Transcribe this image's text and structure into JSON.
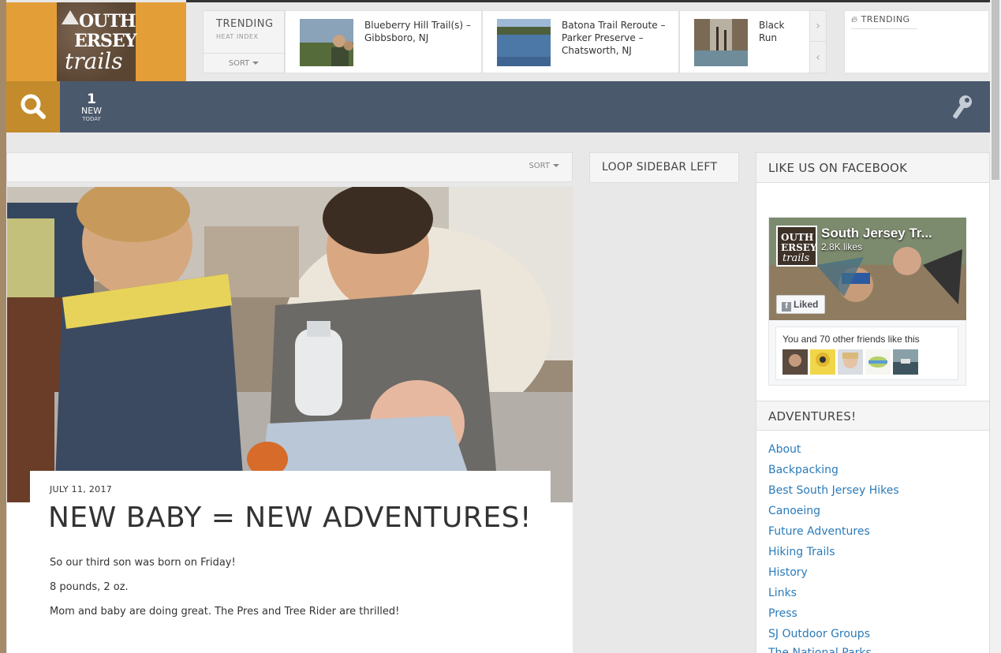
{
  "site": {
    "logo_text": "South Jersey Trails"
  },
  "trending": {
    "label": "TRENDING",
    "sublabel": "HEAT INDEX",
    "sort_label": "SORT",
    "items": [
      {
        "title": "Blueberry Hill Trail(s) – Gibbsboro, NJ"
      },
      {
        "title": "Batona Trail Reroute – Parker Preserve – Chatsworth, NJ"
      },
      {
        "title": "Black Run Trails – Eve"
      }
    ],
    "widget_label": "TRENDING"
  },
  "navbar": {
    "new_count": "1",
    "new_label": "NEW",
    "today_label": "TODAY"
  },
  "content": {
    "sort_label": "SORT",
    "post": {
      "date": "JULY 11, 2017",
      "title": "NEW BABY = NEW ADVENTURES!",
      "paragraphs": [
        "So our third son was born on Friday!",
        "8 pounds, 2 oz.",
        "Mom and baby are doing great.  The Pres and Tree Rider are thrilled!"
      ]
    }
  },
  "sidebar_left": {
    "title": "LOOP SIDEBAR LEFT"
  },
  "sidebar_right": {
    "facebook": {
      "title": "LIKE US ON FACEBOOK",
      "page_name": "South Jersey Tr...",
      "likes": "2.8K likes",
      "liked_label": "Liked",
      "friends_text": "You and 70 other friends like this"
    },
    "adventures": {
      "title": "ADVENTURES!",
      "categories": [
        "About",
        "Backpacking",
        "Best South Jersey Hikes",
        "Canoeing",
        "Future Adventures",
        "Hiking Trails",
        "History",
        "Links",
        "Press",
        "SJ Outdoor Groups",
        "The National Parks"
      ]
    }
  },
  "colors": {
    "logo_bg": "#e39e37",
    "navbar": "#4b596d",
    "search_bg": "#c48b2c",
    "link": "#2b7bb9"
  },
  "icons": [
    "search-icon",
    "key-icon",
    "chevron-right-icon",
    "chevron-left-icon",
    "fire-icon",
    "caret-down-icon",
    "facebook-icon"
  ]
}
